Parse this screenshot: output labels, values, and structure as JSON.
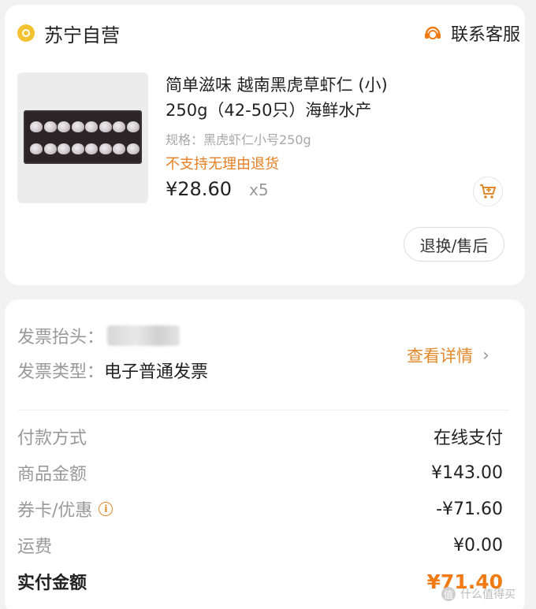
{
  "store": {
    "name": "苏宁自营",
    "service_label": "联系客服",
    "icon": "store-badge-icon",
    "service_icon": "customer-service-icon"
  },
  "product": {
    "title": "简单滋味 越南黑虎草虾仁 (小) 250g（42-50只）海鲜水产",
    "spec": "规格：黑虎虾仁小号250g",
    "return_policy": "不支持无理由退货",
    "price": "¥28.60",
    "quantity": "x5",
    "cart_icon": "add-to-cart-icon",
    "after_sale_label": "退换/售后"
  },
  "invoice": {
    "title_label": "发票抬头：",
    "type_label": "发票类型：",
    "type_value": "电子普通发票",
    "detail_label": "查看详情",
    "detail_icon": "chevron-right-icon"
  },
  "fees": {
    "payment_method_label": "付款方式",
    "payment_method_value": "在线支付",
    "goods_amount_label": "商品金额",
    "goods_amount_value": "¥143.00",
    "coupon_label": "券卡/优惠",
    "coupon_value": "-¥71.60",
    "shipping_label": "运费",
    "shipping_value": "¥0.00",
    "total_label": "实付金额",
    "total_value": "¥71.40"
  },
  "watermark": {
    "text": "什么值得买",
    "icon": "smzdm-logo-icon"
  },
  "colors": {
    "accent_orange": "#f07a14",
    "warning_orange": "#e67e22",
    "gold": "#f2c230",
    "muted_text": "#999999"
  }
}
